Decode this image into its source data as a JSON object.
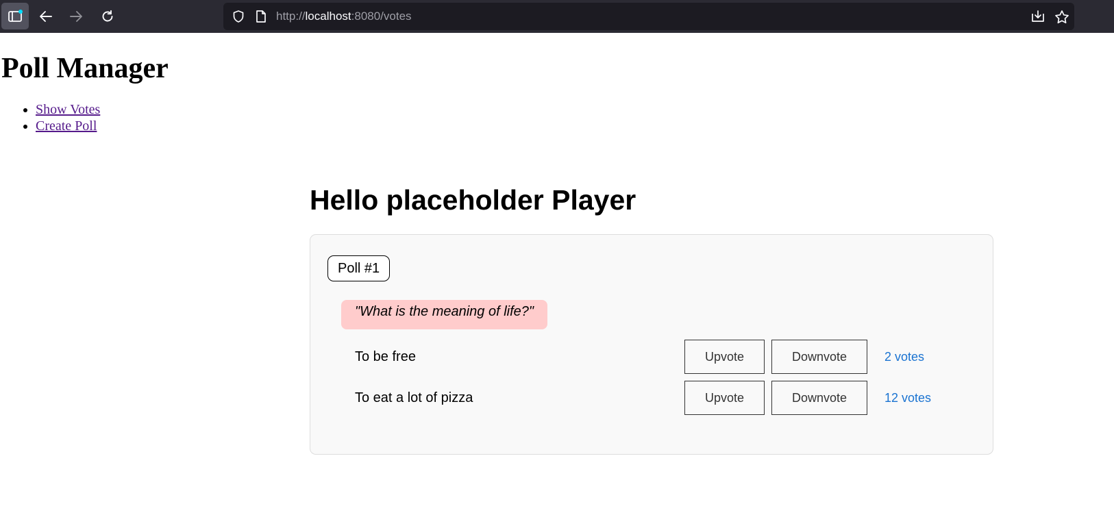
{
  "browser": {
    "url_prefix": "http://",
    "url_host": "localhost",
    "url_rest": ":8080/votes",
    "icons": [
      "sidebar-icon",
      "back-arrow-icon",
      "forward-arrow-icon",
      "reload-icon",
      "shield-icon",
      "page-icon",
      "download-icon",
      "star-icon"
    ]
  },
  "page": {
    "title": "Poll Manager",
    "nav": [
      {
        "label": "Show Votes"
      },
      {
        "label": "Create Poll"
      }
    ],
    "greeting": "Hello placeholder Player"
  },
  "poll": {
    "tag": "Poll #1",
    "question": "\"What is the meaning of life?\"",
    "options": [
      {
        "text": "To be free",
        "upvote_label": "Upvote",
        "downvote_label": "Downvote",
        "votes_label": "2 votes"
      },
      {
        "text": "To eat a lot of pizza",
        "upvote_label": "Upvote",
        "downvote_label": "Downvote",
        "votes_label": "12 votes"
      }
    ]
  },
  "colors": {
    "chrome_bg": "#2b2a33",
    "urlbar_bg": "#1c1b22",
    "question_bg": "#ffcccc",
    "votes_text": "#1a73d1",
    "visited_link": "#551a8b"
  }
}
